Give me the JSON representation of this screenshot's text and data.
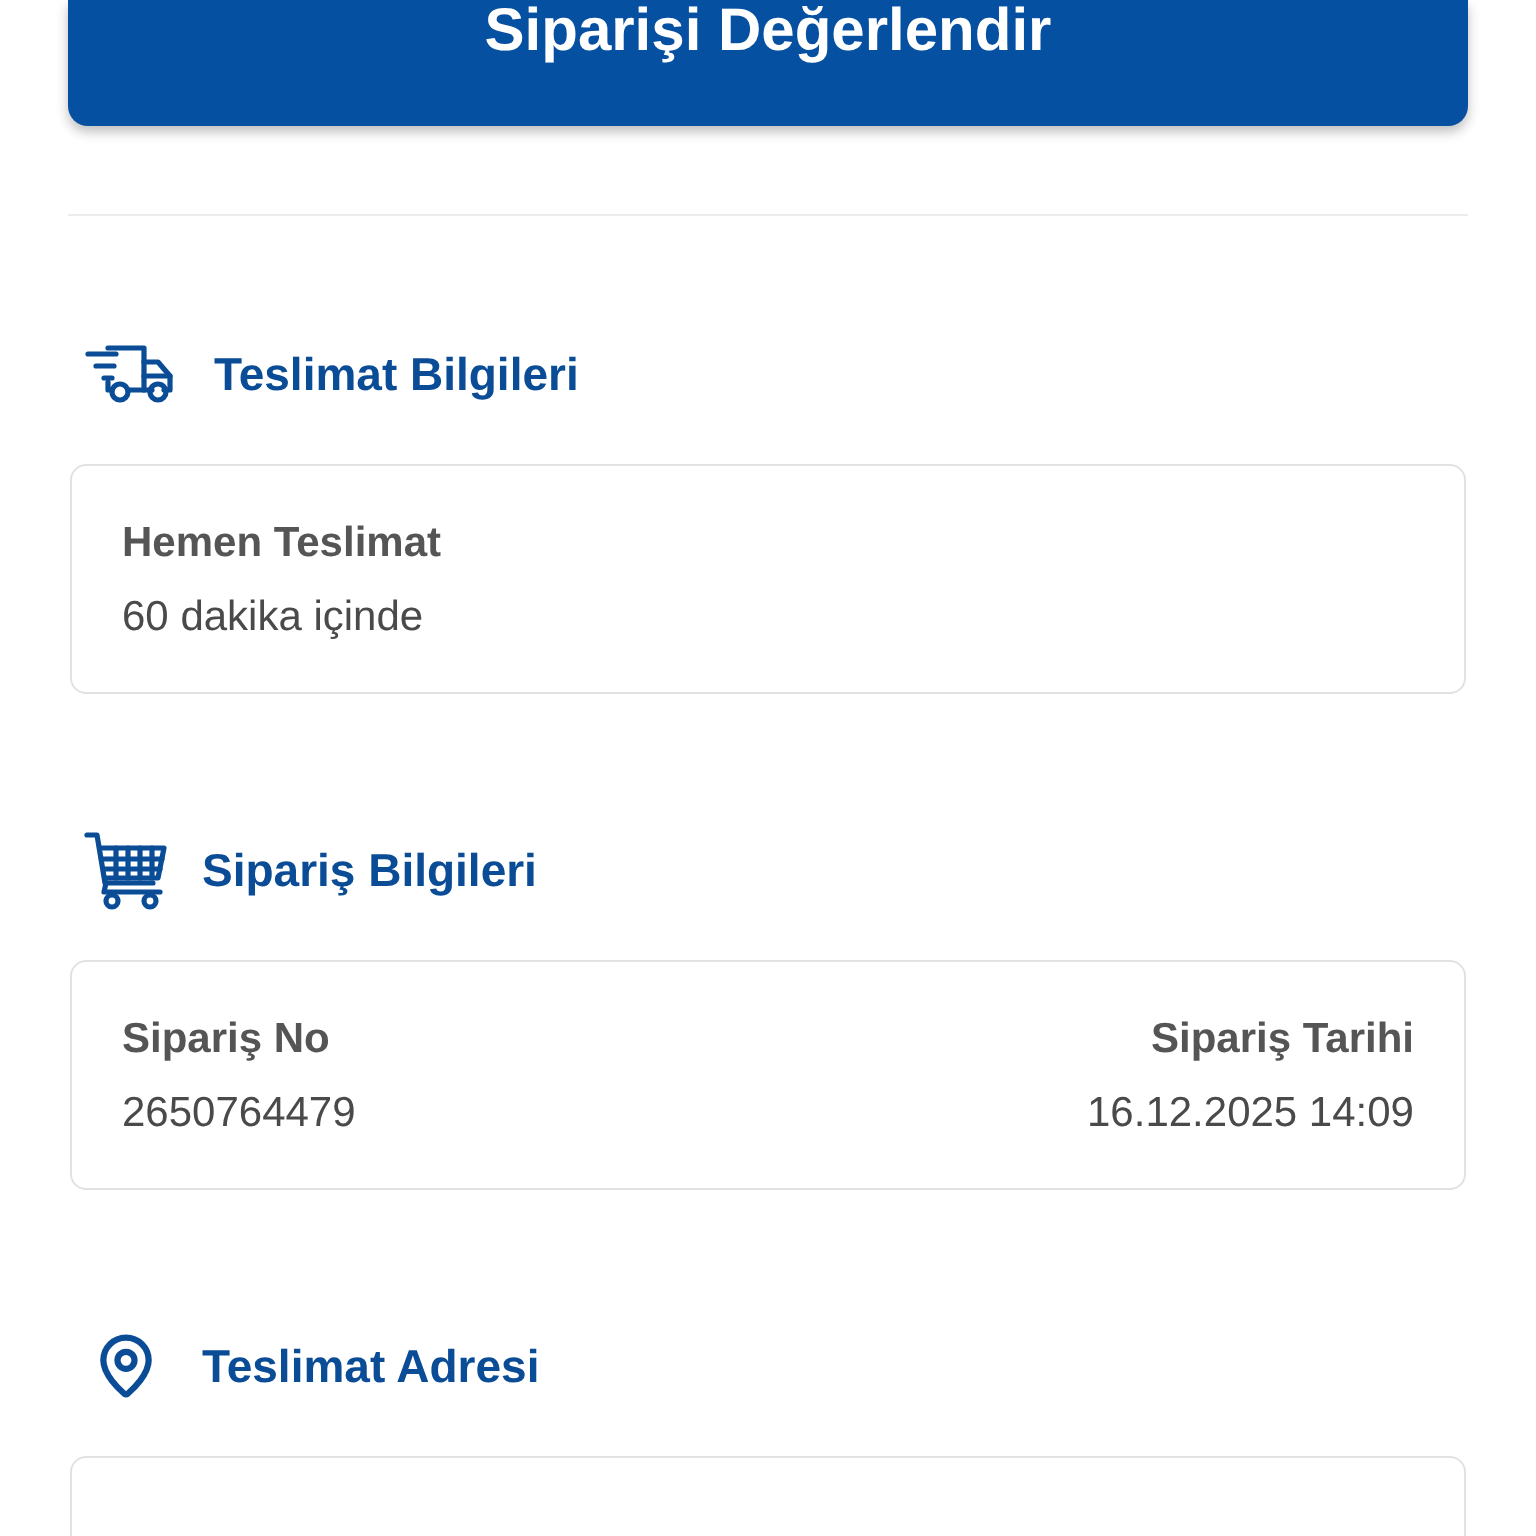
{
  "primary_button": {
    "label": "Siparişi Değerlendir"
  },
  "sections": [
    {
      "kind": "delivery",
      "title": "Teslimat Bilgileri",
      "card": {
        "kind": "stacked",
        "fields": [
          {
            "label": "Hemen Teslimat",
            "value": "60 dakika içinde"
          }
        ]
      }
    },
    {
      "kind": "order",
      "title": "Sipariş Bilgileri",
      "card": {
        "kind": "split",
        "fields": [
          {
            "label": "Sipariş No",
            "value": "2650764479"
          },
          {
            "label": "Sipariş Tarihi",
            "value": "16.12.2025 14:09"
          }
        ]
      }
    },
    {
      "kind": "address",
      "title": "Teslimat Adresi"
    }
  ]
}
